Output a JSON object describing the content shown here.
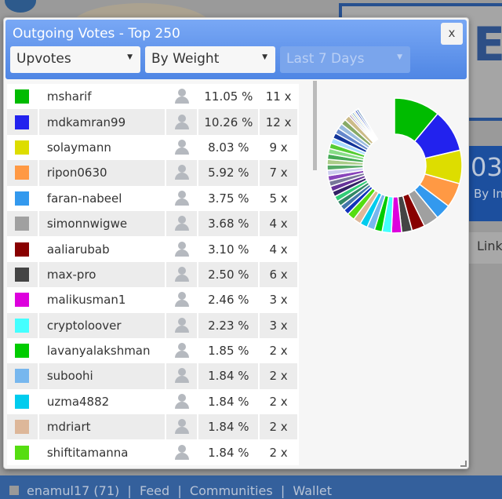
{
  "background": {
    "number": "03",
    "subtitle": "By In",
    "link": "Link",
    "nav": [
      "enamul17 (71)",
      "Feed",
      "Communities",
      "Wallet"
    ],
    "big_text": "E"
  },
  "modal": {
    "title": "Outgoing Votes - Top 250",
    "close": "x",
    "filters": [
      {
        "value": "Upvotes",
        "enabled": true
      },
      {
        "value": "By Weight",
        "enabled": true
      },
      {
        "value": "Last 7 Days",
        "enabled": false
      }
    ],
    "rows": [
      {
        "color": "#00bb00",
        "name": "msharif",
        "pct": "11.05 %",
        "count": "11 x"
      },
      {
        "color": "#2222ee",
        "name": "mdkamran99",
        "pct": "10.26 %",
        "count": "12 x"
      },
      {
        "color": "#dddd00",
        "name": "solaymann",
        "pct": "8.03 %",
        "count": "9 x"
      },
      {
        "color": "#ff9944",
        "name": "ripon0630",
        "pct": "5.92 %",
        "count": "7 x"
      },
      {
        "color": "#3399ee",
        "name": "faran-nabeel",
        "pct": "3.75 %",
        "count": "5 x"
      },
      {
        "color": "#a0a0a0",
        "name": "simonnwigwe",
        "pct": "3.68 %",
        "count": "4 x"
      },
      {
        "color": "#880000",
        "name": "aaliarubab",
        "pct": "3.10 %",
        "count": "4 x"
      },
      {
        "color": "#444444",
        "name": "max-pro",
        "pct": "2.50 %",
        "count": "6 x"
      },
      {
        "color": "#dd00dd",
        "name": "malikusman1",
        "pct": "2.46 %",
        "count": "3 x"
      },
      {
        "color": "#44ffff",
        "name": "cryptoloover",
        "pct": "2.23 %",
        "count": "3 x"
      },
      {
        "color": "#00cc00",
        "name": "lavanyalakshman",
        "pct": "1.85 %",
        "count": "2 x"
      },
      {
        "color": "#77b7ee",
        "name": "suboohi",
        "pct": "1.84 %",
        "count": "2 x"
      },
      {
        "color": "#00ccee",
        "name": "uzma4882",
        "pct": "1.84 %",
        "count": "2 x"
      },
      {
        "color": "#ddb799",
        "name": "mdriart",
        "pct": "1.84 %",
        "count": "2 x"
      },
      {
        "color": "#55dd11",
        "name": "shiftitamanna",
        "pct": "1.84 %",
        "count": "2 x"
      }
    ]
  },
  "chart_data": {
    "type": "pie",
    "donut": true,
    "categories": [
      "msharif",
      "mdkamran99",
      "solaymann",
      "ripon0630",
      "faran-nabeel",
      "simonnwigwe",
      "aaliarubab",
      "max-pro",
      "malikusman1",
      "cryptoloover",
      "lavanyalakshman",
      "suboohi",
      "uzma4882",
      "mdriart",
      "shiftitamanna"
    ],
    "values": [
      11.05,
      10.26,
      8.03,
      5.92,
      3.75,
      3.68,
      3.1,
      2.5,
      2.46,
      2.23,
      1.85,
      1.84,
      1.84,
      1.84,
      1.84
    ]
  }
}
